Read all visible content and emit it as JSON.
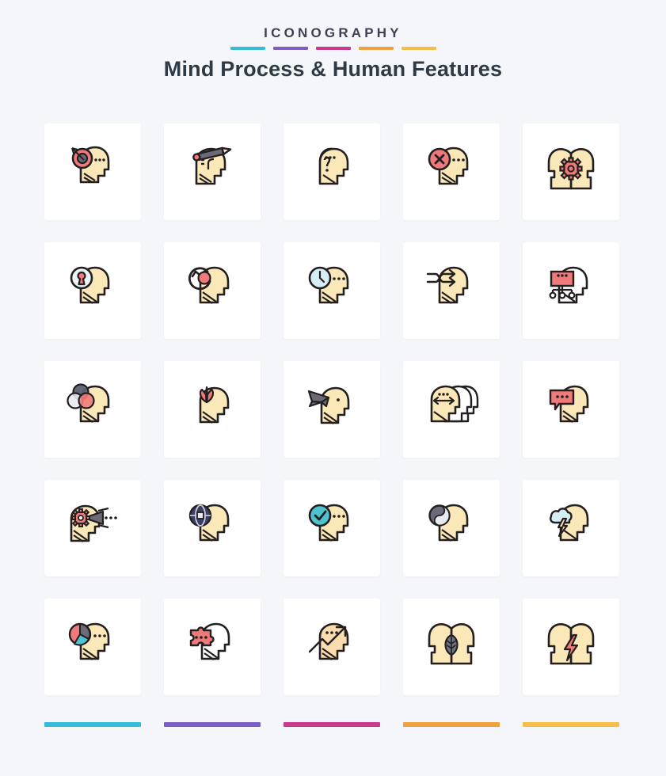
{
  "header": {
    "brand_word": "ICONOGRAPHY",
    "title": "Mind Process & Human Features",
    "accent_bars": [
      "#35bcdb",
      "#7b5fc4",
      "#c93a8f",
      "#f0a03c",
      "#f5bf45"
    ]
  },
  "palette": {
    "background": "#f4f6f9",
    "card": "#ffffff",
    "outline": "#231f20",
    "skin": "#fbe8b8",
    "red": "#ef6b6b",
    "pink": "#f07a7a",
    "cyan": "#bfe8f0",
    "teal": "#4ec3cf",
    "grey": "#6b6b78",
    "light_grey": "#e8eaf2",
    "white": "#ffffff"
  },
  "footer": {
    "accent_bars": [
      "#35bcdb",
      "#7b5fc4",
      "#c93a8f",
      "#f0a03c",
      "#f5bf45"
    ]
  },
  "grid": {
    "columns": 5,
    "rows": 5,
    "total_icons": 25,
    "icons": [
      {
        "name": "target-head-icon",
        "label": "Head with target and arrow"
      },
      {
        "name": "pencil-head-icon",
        "label": "Head with pencil"
      },
      {
        "name": "question-head-icon",
        "label": "Head with question mark"
      },
      {
        "name": "cancel-head-icon",
        "label": "Head with red cross"
      },
      {
        "name": "two-heads-gear-icon",
        "label": "Two heads with gear"
      },
      {
        "name": "lock-head-icon",
        "label": "Head with keyhole"
      },
      {
        "name": "refresh-head-icon",
        "label": "Head with refresh arrow"
      },
      {
        "name": "clock-head-icon",
        "label": "Head with clock"
      },
      {
        "name": "shuffle-head-icon",
        "label": "Head with shuffle arrows"
      },
      {
        "name": "sitemap-head-icon",
        "label": "Head with hierarchy chart"
      },
      {
        "name": "venn-head-icon",
        "label": "Head with venn circles"
      },
      {
        "name": "flower-head-icon",
        "label": "Head with lotus flower"
      },
      {
        "name": "bird-head-icon",
        "label": "Head with origami bird"
      },
      {
        "name": "multiple-heads-icon",
        "label": "Stacked heads with arrow"
      },
      {
        "name": "chat-head-icon",
        "label": "Head with speech bubble"
      },
      {
        "name": "gear-vision-head-icon",
        "label": "Head with gear and vision cone"
      },
      {
        "name": "globe-head-icon",
        "label": "Head with globe"
      },
      {
        "name": "check-head-icon",
        "label": "Head with check mark"
      },
      {
        "name": "yin-yang-head-icon",
        "label": "Head with yin yang"
      },
      {
        "name": "brainstorm-head-icon",
        "label": "Head with cloud and lightning"
      },
      {
        "name": "pie-chart-head-icon",
        "label": "Head with pie chart"
      },
      {
        "name": "puzzle-head-icon",
        "label": "Head with puzzle piece"
      },
      {
        "name": "growth-head-icon",
        "label": "Head with rising arrow"
      },
      {
        "name": "two-heads-leaf-icon",
        "label": "Two heads with leaf"
      },
      {
        "name": "two-heads-bolt-icon",
        "label": "Two heads with lightning bolt"
      }
    ]
  }
}
